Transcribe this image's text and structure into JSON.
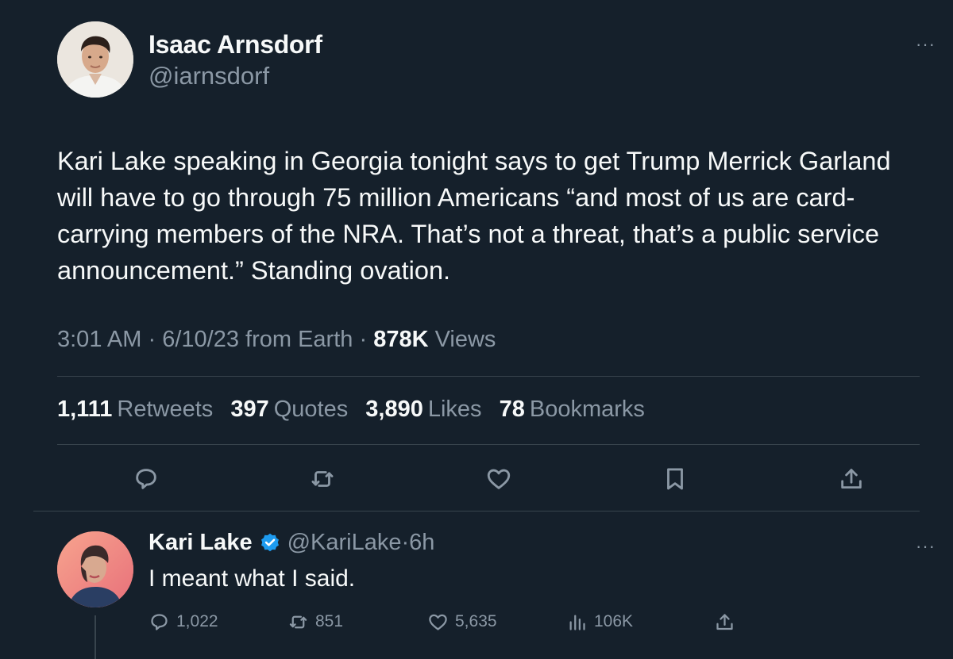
{
  "main_tweet": {
    "author": {
      "name": "Isaac Arnsdorf",
      "handle": "@iarnsdorf"
    },
    "text": "Kari Lake speaking in Georgia tonight says to get Trump Merrick Garland will have to go through 75 million Americans “and most of us are card-carrying members of the NRA. That’s not a threat, that’s a public service announcement.” Standing ovation.",
    "time": "3:01 AM",
    "date": "6/10/23",
    "source": "from Earth",
    "separator": "·",
    "views_count": "878K",
    "views_label": "Views",
    "stats": {
      "retweets": {
        "count": "1,111",
        "label": "Retweets"
      },
      "quotes": {
        "count": "397",
        "label": "Quotes"
      },
      "likes": {
        "count": "3,890",
        "label": "Likes"
      },
      "bookmarks": {
        "count": "78",
        "label": "Bookmarks"
      }
    },
    "actions": [
      "reply-icon",
      "retweet-icon",
      "like-icon",
      "bookmark-icon",
      "share-icon"
    ],
    "more": "···"
  },
  "reply": {
    "author": {
      "name": "Kari Lake",
      "handle": "@KariLake",
      "verified": true
    },
    "age": "6h",
    "separator": "·",
    "text": "I meant what I said.",
    "counts": {
      "replies": "1,022",
      "retweets": "851",
      "likes": "5,635",
      "views": "106K"
    },
    "more": "···"
  },
  "colors": {
    "background": "#15202b",
    "primary_text": "#f7f9f9",
    "secondary_text": "#8b98a5",
    "divider": "#38444d",
    "verified": "#1d9bf0"
  }
}
